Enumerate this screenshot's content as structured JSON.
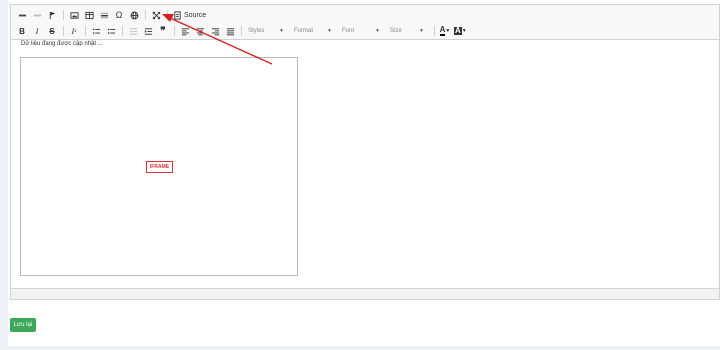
{
  "toolbar": {
    "source_label": "Source",
    "styles_label": "Styles",
    "format_label": "Format",
    "font_label": "Font",
    "size_label": "Size",
    "font_color_label": "A",
    "bg_color_label": "A"
  },
  "editor": {
    "loading_text": "Dữ liệu đang được cập nhật ...",
    "iframe_placeholder": "IFRAME"
  },
  "actions": {
    "save_label": "Lưu lại"
  },
  "colors": {
    "annotation_arrow": "#d42020",
    "save_button": "#3ca95a",
    "iframe_tag": "#e03030"
  }
}
